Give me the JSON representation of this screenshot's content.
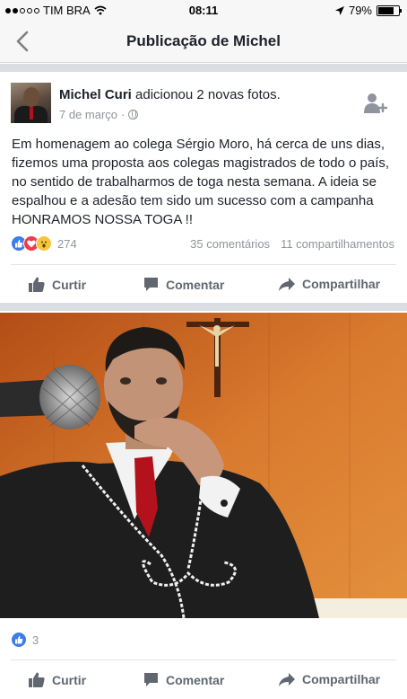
{
  "status_bar": {
    "carrier": "TIM BRA",
    "time": "08:11",
    "battery": "79%",
    "battery_level": 0.79
  },
  "nav": {
    "title": "Publicação de Michel"
  },
  "post": {
    "author": "Michel Curi",
    "action_text": " adicionou 2 novas fotos.",
    "date": "7 de março",
    "text": "Em homenagem ao colega Sérgio Moro, há cerca de uns dias, fizemos uma proposta aos colegas magistrados de todo o país, no sentido de trabalharmos de toga nesta semana. A ideia se espalhou e a adesão tem sido um sucesso com a campanha HONRAMOS NOSSA TOGA !!",
    "reaction_count": "274",
    "comments": "35 comentários",
    "shares": "11 compartilhamentos"
  },
  "actions": {
    "like": "Curtir",
    "comment": "Comentar",
    "share": "Compartilhar"
  },
  "photo": {
    "like_count": "3"
  },
  "colors": {
    "accent": "#3b7de9",
    "love": "#f0394d",
    "wow": "#f7c53c",
    "muted_text": "#90949c",
    "action_text": "#606770"
  }
}
